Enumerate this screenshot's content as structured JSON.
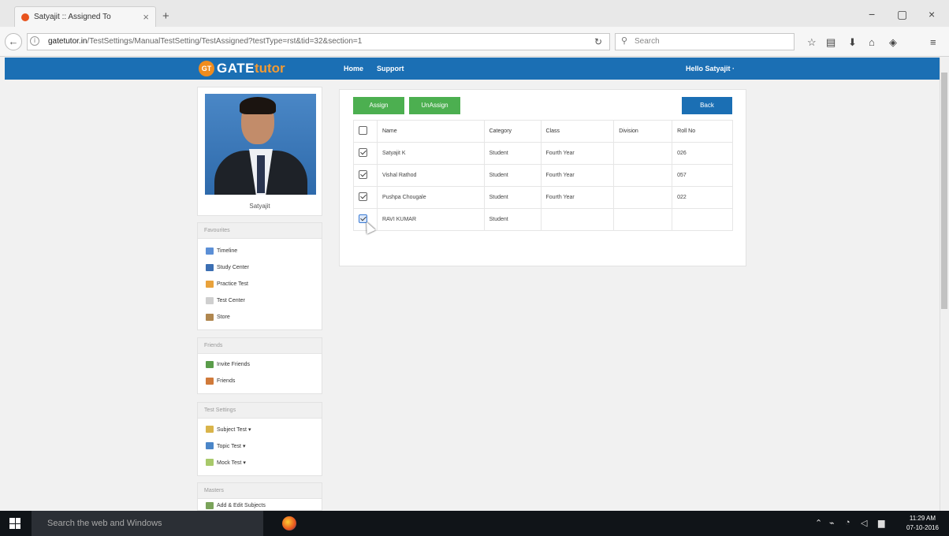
{
  "browser": {
    "tab_title": "Satyajit :: Assigned To",
    "tab_close": "×",
    "new_tab": "+",
    "url_host": "gatetutor.in",
    "url_path": "/TestSettings/ManualTestSetting/TestAssigned?testType=rst&tid=32&section=1",
    "search_placeholder": "Search",
    "window_controls": [
      "−",
      "▢",
      "×"
    ]
  },
  "site": {
    "logo_gate": "GATE",
    "logo_tutor": "tutor",
    "logo_badge": "GT",
    "nav": [
      "Home",
      "Support"
    ],
    "greeting": "Hello Satyajit ·"
  },
  "profile": {
    "name": "Satyajit"
  },
  "sidebar": {
    "favourites": {
      "title": "Favourites",
      "items": [
        "Timeline",
        "Study Center",
        "Practice Test",
        "Test Center",
        "Store"
      ]
    },
    "friends": {
      "title": "Friends",
      "items": [
        "Invite Friends",
        "Friends"
      ]
    },
    "test_settings": {
      "title": "Test Settings",
      "items": [
        "Subject Test ▾",
        "Topic Test ▾",
        "Mock Test ▾"
      ]
    },
    "masters": {
      "title": "Masters",
      "items": [
        "Add & Edit Subjects"
      ]
    }
  },
  "actions": {
    "assign": "Assign",
    "unassign": "UnAssign",
    "back": "Back"
  },
  "table": {
    "headers": [
      "Name",
      "Category",
      "Class",
      "Division",
      "Roll No"
    ],
    "rows": [
      {
        "name": "Satyajit K",
        "category": "Student",
        "class": "Fourth Year",
        "division": "",
        "roll": "026",
        "checked": true
      },
      {
        "name": "Vishal Rathod",
        "category": "Student",
        "class": "Fourth Year",
        "division": "",
        "roll": "057",
        "checked": true
      },
      {
        "name": "Pushpa Chougale",
        "category": "Student",
        "class": "Fourth Year",
        "division": "",
        "roll": "022",
        "checked": true
      },
      {
        "name": "RAVI KUMAR",
        "category": "Student",
        "class": "",
        "division": "",
        "roll": "",
        "checked": true
      }
    ]
  },
  "taskbar": {
    "search": "Search the web and Windows",
    "time": "11:29 AM",
    "date": "07-10-2016"
  }
}
